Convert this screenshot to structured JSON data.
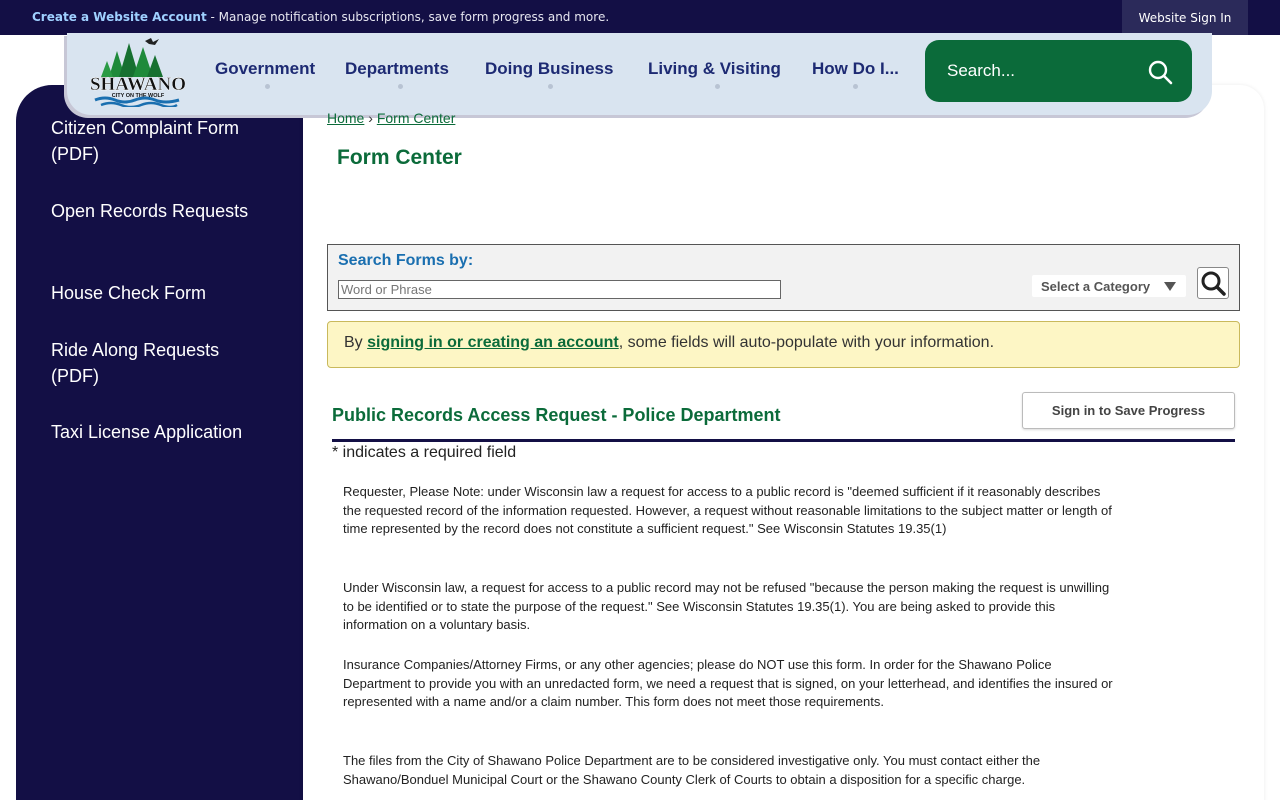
{
  "topbar": {
    "create_account_link": "Create a Website Account",
    "promo_text": " - Manage notification subscriptions, save form progress and more.",
    "sign_in": "Website Sign In"
  },
  "header": {
    "logo_name": "SHAWANO",
    "logo_tagline": "CITY ON THE WOLF",
    "nav": [
      "Government",
      "Departments",
      "Doing Business",
      "Living & Visiting",
      "How Do I..."
    ],
    "search_placeholder": "Search..."
  },
  "sidebar": {
    "items": [
      {
        "label": "Citizen Complaint Form (PDF)"
      },
      {
        "label": "Open Records Requests"
      },
      {
        "label": "House Check Form"
      },
      {
        "label": "Ride Along Requests (PDF)"
      },
      {
        "label": "Taxi License Application"
      }
    ]
  },
  "breadcrumb": {
    "home": "Home",
    "separator": "›",
    "current": "Form Center"
  },
  "page_title": "Form Center",
  "search_forms": {
    "label": "Search Forms by:",
    "placeholder": "Word or Phrase",
    "category": "Select a Category"
  },
  "notice": {
    "prefix": "By ",
    "link": "signing in or creating an account",
    "suffix": ", some fields will auto-populate with your information."
  },
  "form": {
    "title": "Public Records Access Request - Police Department",
    "save_button": "Sign in to Save Progress",
    "required_note": "* indicates a required field",
    "paragraphs": [
      "Requester, Please Note: under Wisconsin law a request for access to a public record is \"deemed sufficient if it reasonably describes the requested record of the information requested. However, a request without reasonable limitations to the subject matter or length of time represented by the record does not constitute a sufficient request.\" See Wisconsin Statutes 19.35(1)",
      "Under Wisconsin law, a request for access to a public record may not be refused \"because the person making the request is unwilling to be identified or to state the purpose of the request.\" See Wisconsin Statutes 19.35(1). You are being asked to provide this information on a voluntary basis.",
      "Insurance Companies/Attorney Firms, or any other agencies; please do NOT use this form. In order for the Shawano Police Department to provide you with an unredacted form, we need a request that is signed, on your letterhead, and identifies the insured or represented with a name and/or a claim number. This form does not meet those requirements.",
      "The files from the City of Shawano Police Department are to be considered investigative only. You must contact either the Shawano/Bonduel Municipal Court or the Shawano County Clerk of Courts to obtain a disposition for a specific charge."
    ]
  },
  "colors": {
    "navy": "#130f45",
    "green": "#0b6b3a",
    "header_bg": "#d9e4f0",
    "notice_bg": "#fdf6c5"
  }
}
